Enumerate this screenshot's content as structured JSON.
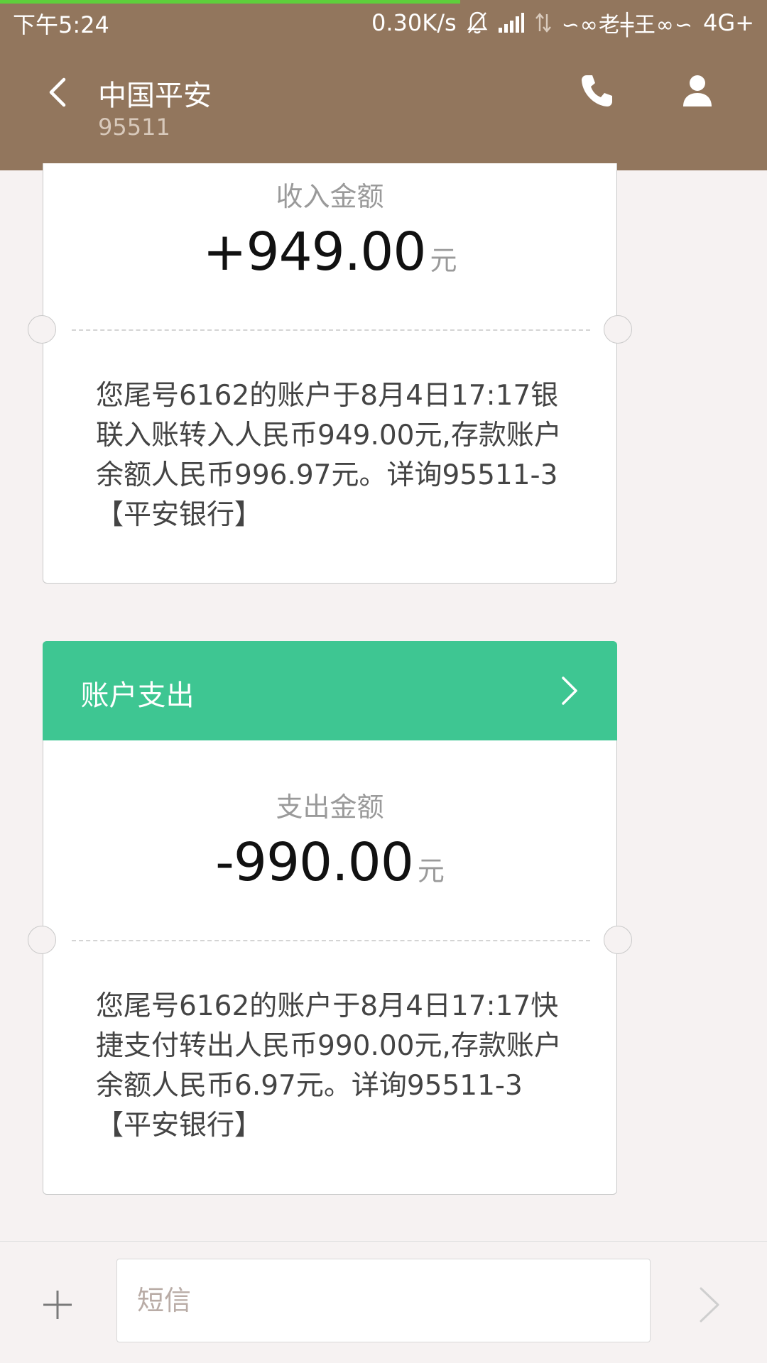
{
  "status_bar": {
    "time": "下午5:24",
    "net_speed": "0.30K/s",
    "carrier": "∽∞老╪王∞∽",
    "network_type": "4G+",
    "icons": [
      "mute-bell-icon",
      "signal-bars-icon",
      "data-transfer-icon"
    ]
  },
  "header": {
    "contact_name": "中国平安",
    "contact_number": "95511",
    "icons": [
      "back-arrow-icon",
      "phone-icon",
      "person-icon"
    ]
  },
  "messages": [
    {
      "amount_label": "收入金额",
      "amount": "+949.00",
      "unit": "元",
      "body": "您尾号6162的账户于8月4日17:17银联入账转入人民币949.00元,存款账户余额人民币996.97元。详询95511-3【平安银行】"
    },
    {
      "header_title": "账户支出",
      "amount_label": "支出金额",
      "amount": "-990.00",
      "unit": "元",
      "body": "您尾号6162的账户于8月4日17:17快捷支付转出人民币990.00元,存款账户余额人民币6.97元。详询95511-3【平安银行】"
    }
  ],
  "composer": {
    "placeholder": "短信",
    "icons": [
      "plus-icon",
      "send-arrow-icon"
    ]
  },
  "colors": {
    "header_bg": "#92765d",
    "card_header_bg": "#3ec692",
    "page_bg": "#f6f2f2"
  }
}
